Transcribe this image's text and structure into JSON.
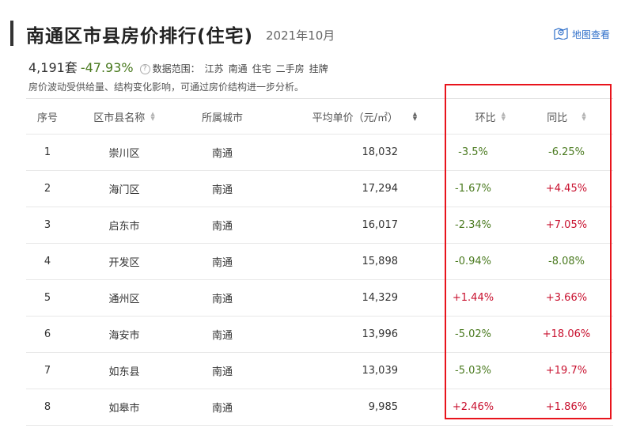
{
  "header": {
    "title": "南通区市县房价排行(住宅)",
    "date": "2021年10月",
    "map_link": "地图查看"
  },
  "stats": {
    "count": "4,191套",
    "change": "-47.93%",
    "help_icon": "?",
    "scope_label": "数据范围：",
    "scope_values": [
      "江苏",
      "南通",
      "住宅",
      "二手房",
      "挂牌"
    ]
  },
  "note": "房价波动受供给量、结构变化影响，可通过房价结构进一步分析。",
  "table": {
    "headers": {
      "index": "序号",
      "name": "区市县名称",
      "city": "所属城市",
      "price": "平均单价（元/㎡）",
      "mom": "环比",
      "yoy": "同比"
    },
    "rows": [
      {
        "index": "1",
        "name": "崇川区",
        "city": "南通",
        "price": "18,032",
        "mom": "-3.5%",
        "yoy": "-6.25%"
      },
      {
        "index": "2",
        "name": "海门区",
        "city": "南通",
        "price": "17,294",
        "mom": "-1.67%",
        "yoy": "+4.45%"
      },
      {
        "index": "3",
        "name": "启东市",
        "city": "南通",
        "price": "16,017",
        "mom": "-2.34%",
        "yoy": "+7.05%"
      },
      {
        "index": "4",
        "name": "开发区",
        "city": "南通",
        "price": "15,898",
        "mom": "-0.94%",
        "yoy": "-8.08%"
      },
      {
        "index": "5",
        "name": "通州区",
        "city": "南通",
        "price": "14,329",
        "mom": "+1.44%",
        "yoy": "+3.66%"
      },
      {
        "index": "6",
        "name": "海安市",
        "city": "南通",
        "price": "13,996",
        "mom": "-5.02%",
        "yoy": "+18.06%"
      },
      {
        "index": "7",
        "name": "如东县",
        "city": "南通",
        "price": "13,039",
        "mom": "-5.03%",
        "yoy": "+19.7%"
      },
      {
        "index": "8",
        "name": "如皋市",
        "city": "南通",
        "price": "9,985",
        "mom": "+2.46%",
        "yoy": "+1.86%"
      }
    ]
  },
  "colors": {
    "negative": "#4a7a1f",
    "positive": "#c8102e",
    "highlight": "#e8141c",
    "link": "#2d6ec9"
  }
}
